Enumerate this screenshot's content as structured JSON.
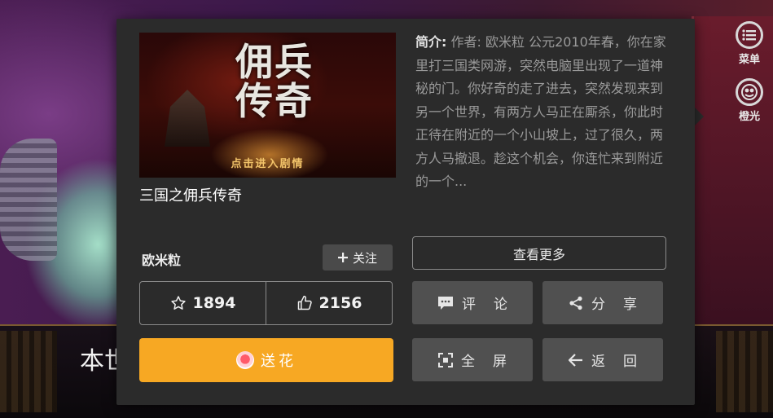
{
  "background": {
    "dialog_text": "本世"
  },
  "side_menu": {
    "menu_label": "菜单",
    "orange_label": "橙光"
  },
  "game": {
    "cover_title": "佣兵传奇",
    "cover_cta": "点击进入剧情",
    "title": "三国之佣兵传奇",
    "intro_label": "简介:",
    "intro_text": "作者: 欧米粒 公元2010年春，你在家里打三国类网游，突然电脑里出现了一道神秘的门。你好奇的走了进去，突然发现来到另一个世界，有两方人马正在厮杀，你此时正待在附近的一个小山坡上，过了很久，两方人马撤退。趁这个机会，你连忙来到附近的一个..."
  },
  "author": {
    "name": "欧米粒",
    "follow_label": "关注"
  },
  "more_label": "查看更多",
  "stats": {
    "favorites": "1894",
    "likes": "2156"
  },
  "actions": {
    "flower_label": "送花",
    "comment_label": "评论",
    "share_label": "分享",
    "fullscreen_label": "全屏",
    "back_label": "返回"
  },
  "colors": {
    "panel_bg": "#2b2b2b",
    "flower_btn": "#f7a823",
    "action_btn": "#505050"
  }
}
